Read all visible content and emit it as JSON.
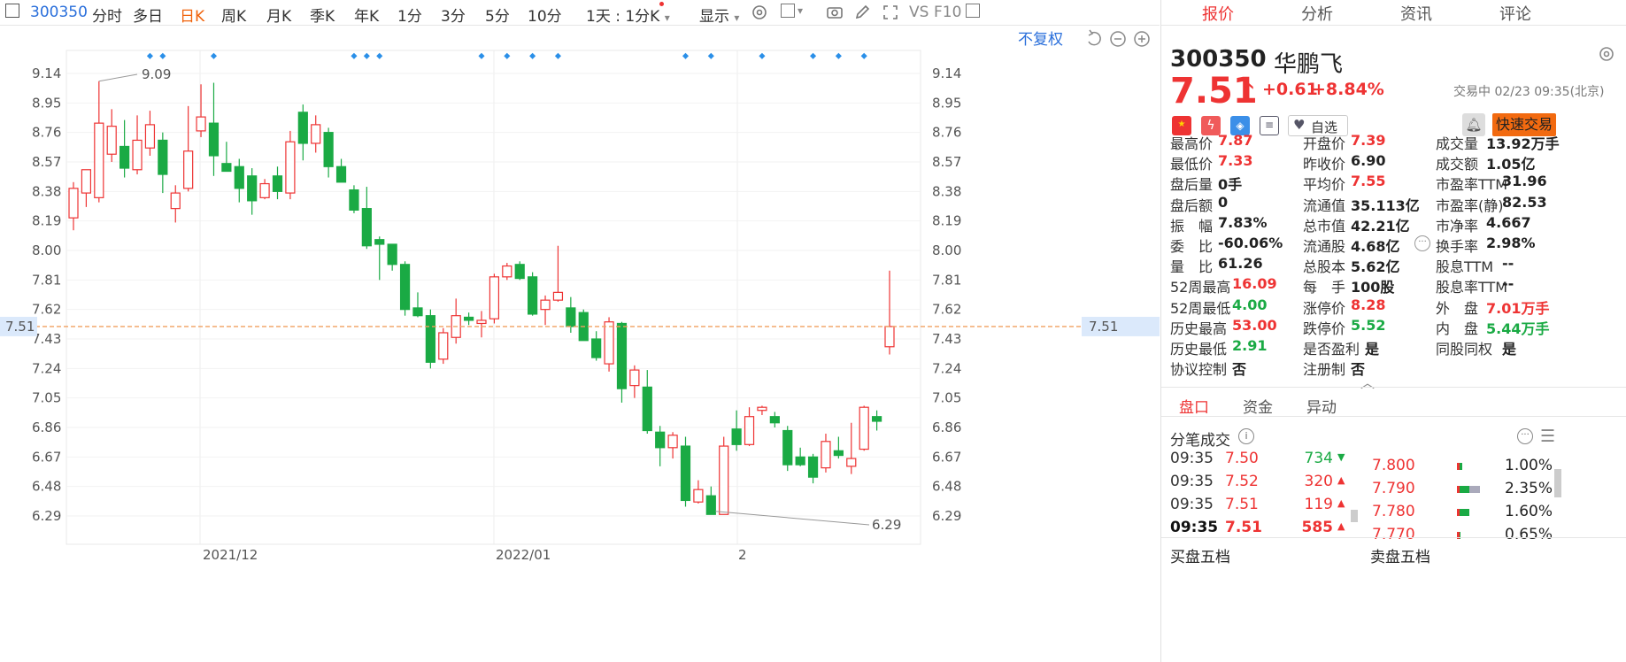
{
  "toolbar": {
    "code": "300350",
    "periods": [
      "分时",
      "多日",
      "日K",
      "周K",
      "月K",
      "季K",
      "年K",
      "1分",
      "3分",
      "5分",
      "10分"
    ],
    "active_period": "日K",
    "interval_select": "1天 : 1分K",
    "display_label": "显示",
    "vs_label": "VS",
    "f10_label": "F10",
    "icons": [
      "settings-icon",
      "square-checkbox-icon",
      "camera-icon",
      "pen-icon",
      "fullscreen-icon",
      "collapse-icon"
    ]
  },
  "chart_overlay": {
    "adjust_label": "不复权",
    "current_price_tag": "7.51",
    "hi_label": "9.09",
    "lo_label": "6.29",
    "icons": [
      "undo-icon",
      "zoom-out-icon",
      "zoom-in-icon"
    ]
  },
  "chart_data": {
    "type": "candlestick",
    "y_ticks": [
      "9.14",
      "8.95",
      "8.76",
      "8.57",
      "8.38",
      "8.19",
      "8.00",
      "7.81",
      "7.62",
      "7.43",
      "7.24",
      "7.05",
      "6.86",
      "6.67",
      "6.48",
      "6.29"
    ],
    "x_ticks": [
      "2021/12",
      "2022/01",
      "2"
    ],
    "ylim": [
      6.18,
      9.26
    ],
    "reference_price": 7.51,
    "colors": {
      "up": "#e33",
      "down": "#1aaa44",
      "ref_line": "#f0a060"
    },
    "candles": [
      {
        "o": 8.21,
        "h": 8.44,
        "l": 8.13,
        "c": 8.4
      },
      {
        "o": 8.37,
        "h": 8.48,
        "l": 8.28,
        "c": 8.52
      },
      {
        "o": 8.34,
        "h": 9.09,
        "l": 8.31,
        "c": 8.82
      },
      {
        "o": 8.62,
        "h": 8.91,
        "l": 8.57,
        "c": 8.8
      },
      {
        "o": 8.67,
        "h": 8.84,
        "l": 8.47,
        "c": 8.53
      },
      {
        "o": 8.52,
        "h": 8.87,
        "l": 8.49,
        "c": 8.71
      },
      {
        "o": 8.66,
        "h": 8.9,
        "l": 8.61,
        "c": 8.81
      },
      {
        "o": 8.71,
        "h": 8.76,
        "l": 8.37,
        "c": 8.49
      },
      {
        "o": 8.27,
        "h": 8.42,
        "l": 8.18,
        "c": 8.37
      },
      {
        "o": 8.4,
        "h": 8.93,
        "l": 8.38,
        "c": 8.64
      },
      {
        "o": 8.77,
        "h": 9.07,
        "l": 8.73,
        "c": 8.86
      },
      {
        "o": 8.82,
        "h": 9.08,
        "l": 8.48,
        "c": 8.61
      },
      {
        "o": 8.56,
        "h": 8.7,
        "l": 8.51,
        "c": 8.51
      },
      {
        "o": 8.54,
        "h": 8.59,
        "l": 8.31,
        "c": 8.4
      },
      {
        "o": 8.48,
        "h": 8.53,
        "l": 8.23,
        "c": 8.32
      },
      {
        "o": 8.34,
        "h": 8.46,
        "l": 8.33,
        "c": 8.43
      },
      {
        "o": 8.48,
        "h": 8.54,
        "l": 8.33,
        "c": 8.38
      },
      {
        "o": 8.37,
        "h": 8.77,
        "l": 8.33,
        "c": 8.7
      },
      {
        "o": 8.89,
        "h": 8.94,
        "l": 8.58,
        "c": 8.69
      },
      {
        "o": 8.69,
        "h": 8.87,
        "l": 8.63,
        "c": 8.81
      },
      {
        "o": 8.76,
        "h": 8.79,
        "l": 8.47,
        "c": 8.54
      },
      {
        "o": 8.54,
        "h": 8.59,
        "l": 8.44,
        "c": 8.44
      },
      {
        "o": 8.39,
        "h": 8.42,
        "l": 8.24,
        "c": 8.26
      },
      {
        "o": 8.27,
        "h": 8.41,
        "l": 8.01,
        "c": 8.03
      },
      {
        "o": 8.07,
        "h": 8.09,
        "l": 7.81,
        "c": 8.04
      },
      {
        "o": 8.04,
        "h": 8.04,
        "l": 7.87,
        "c": 7.91
      },
      {
        "o": 7.91,
        "h": 7.93,
        "l": 7.58,
        "c": 7.62
      },
      {
        "o": 7.63,
        "h": 7.73,
        "l": 7.57,
        "c": 7.58
      },
      {
        "o": 7.58,
        "h": 7.62,
        "l": 7.24,
        "c": 7.28
      },
      {
        "o": 7.3,
        "h": 7.5,
        "l": 7.27,
        "c": 7.47
      },
      {
        "o": 7.44,
        "h": 7.69,
        "l": 7.4,
        "c": 7.58
      },
      {
        "o": 7.57,
        "h": 7.6,
        "l": 7.52,
        "c": 7.55
      },
      {
        "o": 7.53,
        "h": 7.61,
        "l": 7.44,
        "c": 7.55
      },
      {
        "o": 7.56,
        "h": 7.85,
        "l": 7.53,
        "c": 7.83
      },
      {
        "o": 7.83,
        "h": 7.92,
        "l": 7.81,
        "c": 7.9
      },
      {
        "o": 7.91,
        "h": 7.93,
        "l": 7.81,
        "c": 7.82
      },
      {
        "o": 7.83,
        "h": 7.86,
        "l": 7.58,
        "c": 7.59
      },
      {
        "o": 7.62,
        "h": 7.71,
        "l": 7.52,
        "c": 7.68
      },
      {
        "o": 7.68,
        "h": 8.03,
        "l": 7.67,
        "c": 7.73
      },
      {
        "o": 7.63,
        "h": 7.7,
        "l": 7.47,
        "c": 7.51
      },
      {
        "o": 7.6,
        "h": 7.62,
        "l": 7.44,
        "c": 7.42
      },
      {
        "o": 7.43,
        "h": 7.48,
        "l": 7.29,
        "c": 7.31
      },
      {
        "o": 7.27,
        "h": 7.57,
        "l": 7.22,
        "c": 7.54
      },
      {
        "o": 7.53,
        "h": 7.54,
        "l": 7.02,
        "c": 7.11
      },
      {
        "o": 7.13,
        "h": 7.26,
        "l": 7.05,
        "c": 7.23
      },
      {
        "o": 7.12,
        "h": 7.23,
        "l": 6.82,
        "c": 6.84
      },
      {
        "o": 6.83,
        "h": 6.87,
        "l": 6.61,
        "c": 6.73
      },
      {
        "o": 6.73,
        "h": 6.83,
        "l": 6.66,
        "c": 6.81
      },
      {
        "o": 6.74,
        "h": 6.8,
        "l": 6.35,
        "c": 6.39
      },
      {
        "o": 6.38,
        "h": 6.52,
        "l": 6.37,
        "c": 6.46
      },
      {
        "o": 6.42,
        "h": 6.48,
        "l": 6.32,
        "c": 6.3
      },
      {
        "o": 6.3,
        "h": 6.8,
        "l": 6.3,
        "c": 6.74
      },
      {
        "o": 6.85,
        "h": 6.97,
        "l": 6.71,
        "c": 6.75
      },
      {
        "o": 6.75,
        "h": 6.99,
        "l": 6.74,
        "c": 6.93
      },
      {
        "o": 6.97,
        "h": 7.0,
        "l": 6.94,
        "c": 6.99
      },
      {
        "o": 6.93,
        "h": 6.96,
        "l": 6.86,
        "c": 6.89
      },
      {
        "o": 6.84,
        "h": 6.87,
        "l": 6.58,
        "c": 6.62
      },
      {
        "o": 6.67,
        "h": 6.73,
        "l": 6.61,
        "c": 6.62
      },
      {
        "o": 6.67,
        "h": 6.69,
        "l": 6.5,
        "c": 6.54
      },
      {
        "o": 6.6,
        "h": 6.82,
        "l": 6.57,
        "c": 6.77
      },
      {
        "o": 6.71,
        "h": 6.8,
        "l": 6.66,
        "c": 6.68
      },
      {
        "o": 6.61,
        "h": 6.89,
        "l": 6.56,
        "c": 6.66
      },
      {
        "o": 6.72,
        "h": 7.0,
        "l": 6.71,
        "c": 6.99
      },
      {
        "o": 6.93,
        "h": 6.97,
        "l": 6.84,
        "c": 6.9
      },
      {
        "o": 7.38,
        "h": 7.87,
        "l": 7.33,
        "c": 7.51
      }
    ],
    "marker_candles": [
      6,
      7,
      11,
      22,
      23,
      24,
      32,
      34,
      36,
      38,
      48,
      50,
      54,
      58,
      60,
      62
    ]
  },
  "quote": {
    "code": "300350",
    "name": "华鹏飞",
    "price": "7.51",
    "change": "+0.61",
    "change_pct": "+8.84%",
    "status": "交易中 02/23 09:35(北京)",
    "watch_label": "自选",
    "trade_label": "快速交易",
    "fields": [
      [
        "最高价",
        "7.87",
        "red"
      ],
      [
        "开盘价",
        "7.39",
        "red"
      ],
      [
        "成交量",
        "13.92万手",
        "dark"
      ],
      [
        "最低价",
        "7.33",
        "red"
      ],
      [
        "昨收价",
        "6.90",
        "dark"
      ],
      [
        "成交额",
        "1.05亿",
        "dark"
      ],
      [
        "盘后量",
        "0手",
        "dark"
      ],
      [
        "平均价",
        "7.55",
        "red"
      ],
      [
        "市盈率TTM",
        "31.96",
        "dark"
      ],
      [
        "盘后额",
        "0",
        "dark"
      ],
      [
        "流通值",
        "35.113亿",
        "dark"
      ],
      [
        "市盈率(静)",
        "82.53",
        "dark"
      ],
      [
        "振　幅",
        "7.83%",
        "dark"
      ],
      [
        "总市值",
        "42.21亿",
        "dark"
      ],
      [
        "市净率",
        "4.667",
        "dark"
      ],
      [
        "委　比",
        "-60.06%",
        "dark"
      ],
      [
        "流通股",
        "4.68亿",
        "dark"
      ],
      [
        "换手率",
        "2.98%",
        "dark"
      ],
      [
        "量　比",
        "61.26",
        "dark"
      ],
      [
        "总股本",
        "5.62亿",
        "dark"
      ],
      [
        "股息TTM",
        "--",
        "dark"
      ],
      [
        "52周最高",
        "16.09",
        "red"
      ],
      [
        "每　手",
        "100股",
        "dark"
      ],
      [
        "股息率TTM",
        "--",
        "dark"
      ],
      [
        "52周最低",
        "4.00",
        "green"
      ],
      [
        "涨停价",
        "8.28",
        "red"
      ],
      [
        "外　盘",
        "7.01万手",
        "red"
      ],
      [
        "历史最高",
        "53.00",
        "red"
      ],
      [
        "跌停价",
        "5.52",
        "green"
      ],
      [
        "内　盘",
        "5.44万手",
        "green"
      ],
      [
        "历史最低",
        "2.91",
        "green"
      ],
      [
        "是否盈利",
        "是",
        "dark"
      ],
      [
        "同股同权",
        "是",
        "dark"
      ],
      [
        "协议控制",
        "否",
        "dark"
      ],
      [
        "注册制",
        "否",
        "dark"
      ],
      [
        "",
        ""
      ]
    ]
  },
  "panel_tabs": [
    "报价",
    "分析",
    "资讯",
    "评论"
  ],
  "sub_tabs": [
    "盘口",
    "资金",
    "异动"
  ],
  "trades_title": "分笔成交",
  "trades": [
    {
      "time": "09:35",
      "price": "7.50",
      "vol": "734",
      "dir": "down"
    },
    {
      "time": "09:35",
      "price": "7.52",
      "vol": "320",
      "dir": "up"
    },
    {
      "time": "09:35",
      "price": "7.51",
      "vol": "119",
      "dir": "up"
    },
    {
      "time": "09:35",
      "price": "7.51",
      "vol": "585",
      "dir": "up"
    }
  ],
  "dist": [
    {
      "price": "7.800",
      "pct": "1.00%"
    },
    {
      "price": "7.790",
      "pct": "2.35%"
    },
    {
      "price": "7.780",
      "pct": "1.60%"
    },
    {
      "price": "7.770",
      "pct": "0.65%"
    }
  ],
  "buy5_label": "买盘五档",
  "sell5_label": "卖盘五档"
}
